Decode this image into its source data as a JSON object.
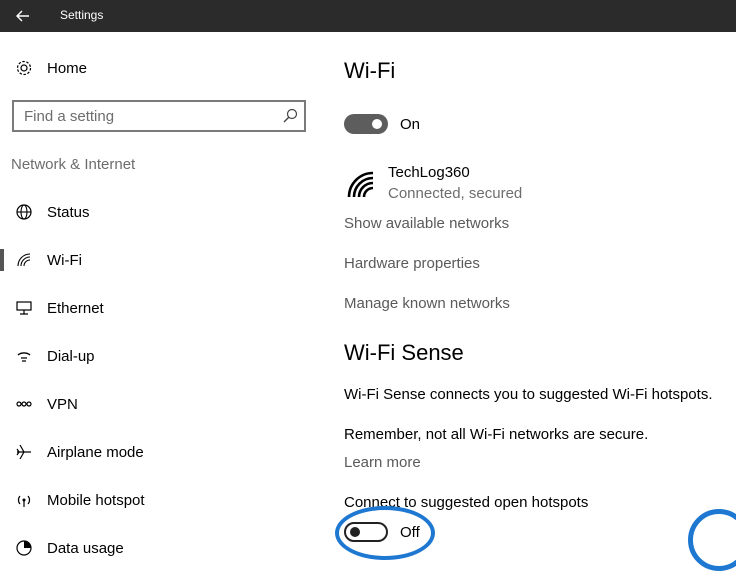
{
  "titlebar": {
    "title": "Settings",
    "back_icon": "arrow-left-icon"
  },
  "sidebar": {
    "home": {
      "label": "Home",
      "icon": "gear-icon"
    },
    "search": {
      "placeholder": "Find a setting",
      "icon": "search-icon"
    },
    "section": "Network & Internet",
    "items": [
      {
        "label": "Status",
        "icon": "globe-icon",
        "selected": false
      },
      {
        "label": "Wi-Fi",
        "icon": "wifi-icon",
        "selected": true
      },
      {
        "label": "Ethernet",
        "icon": "ethernet-icon",
        "selected": false
      },
      {
        "label": "Dial-up",
        "icon": "phone-icon",
        "selected": false
      },
      {
        "label": "VPN",
        "icon": "vpn-icon",
        "selected": false
      },
      {
        "label": "Airplane mode",
        "icon": "airplane-icon",
        "selected": false
      },
      {
        "label": "Mobile hotspot",
        "icon": "hotspot-icon",
        "selected": false
      },
      {
        "label": "Data usage",
        "icon": "data-usage-icon",
        "selected": false
      }
    ]
  },
  "main": {
    "wifi_title": "Wi-Fi",
    "wifi_toggle": {
      "state": "On",
      "on": true
    },
    "network": {
      "name": "TechLog360",
      "status": "Connected, secured",
      "icon": "wifi-signal-icon"
    },
    "links": [
      "Show available networks",
      "Hardware properties",
      "Manage known networks"
    ],
    "sense_title": "Wi-Fi Sense",
    "sense_desc": "Wi-Fi Sense connects you to suggested Wi-Fi hotspots.",
    "sense_warning": "Remember, not all Wi-Fi networks are secure.",
    "learn_more": "Learn more",
    "hotspot_setting": "Connect to suggested open hotspots",
    "hotspot_toggle": {
      "state": "Off",
      "on": false
    }
  },
  "colors": {
    "titlebar": "#2b2b2b",
    "accent_ring": "#1e78d2",
    "toggle_on": "#5d5d5d"
  }
}
